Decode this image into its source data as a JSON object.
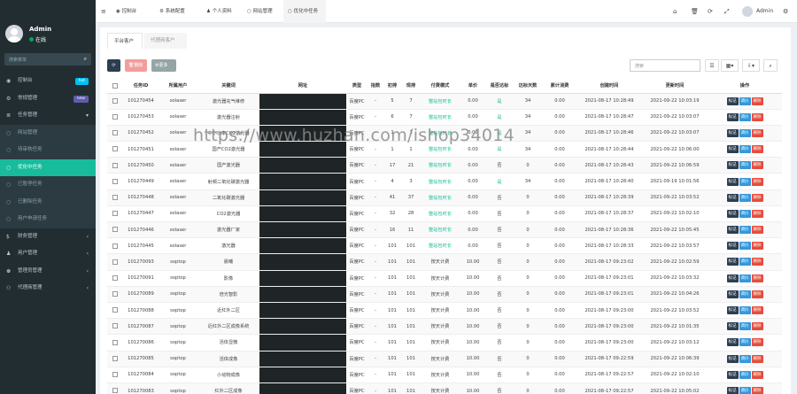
{
  "user": {
    "name": "Admin",
    "status": "在线"
  },
  "sidebar": {
    "search_placeholder": "搜索菜单",
    "items": [
      {
        "label": "控制台",
        "icon": "dashboard-icon",
        "badge": "hot",
        "badge_color": "#00c0ef",
        "kind": "top"
      },
      {
        "label": "常规管理",
        "icon": "gear-icon",
        "badge": "new",
        "badge_color": "#605ca8",
        "kind": "top"
      },
      {
        "label": "任务管理",
        "icon": "list-icon",
        "arrow": "▾",
        "kind": "top"
      },
      {
        "label": "网站管理",
        "icon": "circle-icon",
        "kind": "sub"
      },
      {
        "label": "待审核任务",
        "icon": "circle-icon",
        "kind": "sub"
      },
      {
        "label": "优化中任务",
        "icon": "circle-icon",
        "kind": "active"
      },
      {
        "label": "已暂停任务",
        "icon": "circle-icon",
        "kind": "sub"
      },
      {
        "label": "已删除任务",
        "icon": "circle-icon",
        "kind": "sub"
      },
      {
        "label": "用户申请任务",
        "icon": "circle-icon",
        "kind": "sub"
      },
      {
        "label": "财务管理",
        "icon": "money-icon",
        "arrow": "‹",
        "kind": "top"
      },
      {
        "label": "用户管理",
        "icon": "user-icon",
        "arrow": "‹",
        "kind": "top"
      },
      {
        "label": "管理员管理",
        "icon": "users-icon",
        "arrow": "‹",
        "kind": "top"
      },
      {
        "label": "代理商管理",
        "icon": "group-icon",
        "arrow": "‹",
        "kind": "top"
      }
    ]
  },
  "topnav": {
    "items": [
      "控制台",
      "系统配置",
      "个人资料",
      "网站管理",
      "优化中任务"
    ],
    "admin_name": "Admin"
  },
  "tabs": [
    "平台客户",
    "代理商客户"
  ],
  "toolbar": {
    "delete": "删除",
    "more": "更多",
    "search_placeholder": "搜索"
  },
  "table": {
    "headers": [
      "任务ID",
      "所属用户",
      "关键词",
      "网址",
      "类型",
      "指数",
      "初排",
      "现排",
      "付费模式",
      "单价",
      "是否达标",
      "达标天数",
      "累计消费",
      "创建时间",
      "更新时间",
      "操作"
    ],
    "actions": [
      "标记",
      "调价",
      "删除"
    ],
    "rows": [
      [
        "101270454",
        "xolaser",
        "激光器充气维修",
        "",
        "百度PC",
        "-",
        "5",
        "7",
        "整站包时长",
        "0.00",
        "是",
        "34",
        "0.00",
        "2021-08-17 10:28:49",
        "2021-09-22 10:03:19"
      ],
      [
        "101270453",
        "xolaser",
        "激光器注射",
        "",
        "百度PC",
        "-",
        "6",
        "7",
        "整站包时长",
        "0.00",
        "是",
        "34",
        "0.00",
        "2021-08-17 10:28:47",
        "2021-09-22 10:03:07"
      ],
      [
        "101270452",
        "xolaser",
        "中小功率CO2激光器",
        "",
        "百度PC",
        "-",
        "1",
        "1",
        "整站包时长",
        "0.00",
        "是",
        "34",
        "0.00",
        "2021-08-17 10:28:46",
        "2021-09-22 10:03:07"
      ],
      [
        "101270451",
        "xolaser",
        "国产CO2激光器",
        "",
        "百度PC",
        "-",
        "1",
        "1",
        "整站包时长",
        "0.00",
        "是",
        "34",
        "0.00",
        "2021-08-17 10:28:44",
        "2021-09-22 10:06:00"
      ],
      [
        "101270450",
        "xolaser",
        "国产激光器",
        "",
        "百度PC",
        "-",
        "17",
        "21",
        "整站包时长",
        "0.00",
        "否",
        "0",
        "0.00",
        "2021-08-17 10:28:43",
        "2021-09-22 10:06:59"
      ],
      [
        "101270449",
        "xolaser",
        "射频二氧化碳激光器",
        "",
        "百度PC",
        "-",
        "4",
        "3",
        "整站包时长",
        "0.00",
        "是",
        "34",
        "0.00",
        "2021-08-17 10:28:40",
        "2021-09-19 10:01:56"
      ],
      [
        "101270448",
        "xolaser",
        "二氧化碳激光器",
        "",
        "百度PC",
        "-",
        "41",
        "37",
        "整站包时长",
        "0.00",
        "否",
        "0",
        "0.00",
        "2021-08-17 10:28:39",
        "2021-09-22 10:03:52"
      ],
      [
        "101270447",
        "xolaser",
        "CO2激光器",
        "",
        "百度PC",
        "-",
        "32",
        "28",
        "整站包时长",
        "0.00",
        "否",
        "0",
        "0.00",
        "2021-08-17 10:28:37",
        "2021-09-22 10:02:10"
      ],
      [
        "101270446",
        "xolaser",
        "激光器厂家",
        "",
        "百度PC",
        "-",
        "16",
        "11",
        "整站包时长",
        "0.00",
        "否",
        "0",
        "0.00",
        "2021-08-17 10:28:36",
        "2021-09-22 10:05:45"
      ],
      [
        "101270445",
        "xolaser",
        "激光器",
        "",
        "百度PC",
        "-",
        "101",
        "101",
        "整站包时长",
        "0.00",
        "否",
        "0",
        "0.00",
        "2021-08-17 10:28:33",
        "2021-09-22 10:03:57"
      ],
      [
        "101270093",
        "soptop",
        "晨曦",
        "",
        "百度PC",
        "-",
        "101",
        "101",
        "按天计费",
        "10.00",
        "否",
        "0",
        "0.00",
        "2021-08-17 09:23:02",
        "2021-09-22 10:02:59"
      ],
      [
        "101270091",
        "soptop",
        "影像",
        "",
        "百度PC",
        "-",
        "101",
        "101",
        "按天计费",
        "10.00",
        "否",
        "0",
        "0.00",
        "2021-08-17 09:23:01",
        "2021-09-22 10:03:32"
      ],
      [
        "101270089",
        "soptop",
        "倍光智影",
        "",
        "百度PC",
        "-",
        "101",
        "101",
        "按天计费",
        "10.00",
        "否",
        "0",
        "0.00",
        "2021-08-17 09:23:01",
        "2021-09-22 10:04:26"
      ],
      [
        "101270088",
        "soptop",
        "近红外二区",
        "",
        "百度PC",
        "-",
        "101",
        "101",
        "按天计费",
        "10.00",
        "否",
        "0",
        "0.00",
        "2021-08-17 09:23:00",
        "2021-09-22 10:03:52"
      ],
      [
        "101270087",
        "soptop",
        "近红外二区成像系统",
        "",
        "百度PC",
        "-",
        "101",
        "101",
        "按天计费",
        "10.00",
        "否",
        "0",
        "0.00",
        "2021-08-17 09:23:00",
        "2021-09-22 10:01:35"
      ],
      [
        "101270086",
        "soptop",
        "活体显微",
        "",
        "百度PC",
        "-",
        "101",
        "101",
        "按天计费",
        "10.00",
        "否",
        "0",
        "0.00",
        "2021-08-17 09:23:00",
        "2021-09-22 10:03:12"
      ],
      [
        "101270085",
        "soptop",
        "活体成像",
        "",
        "百度PC",
        "-",
        "101",
        "101",
        "按天计费",
        "10.00",
        "否",
        "0",
        "0.00",
        "2021-08-17 09:22:59",
        "2021-09-22 10:06:39"
      ],
      [
        "101270084",
        "soptop",
        "小动物成像",
        "",
        "百度PC",
        "-",
        "101",
        "101",
        "按天计费",
        "10.00",
        "否",
        "0",
        "0.00",
        "2021-08-17 09:22:57",
        "2021-09-22 10:02:10"
      ],
      [
        "101270083",
        "soptop",
        "红外二区成像",
        "",
        "百度PC",
        "-",
        "101",
        "101",
        "按天计费",
        "10.00",
        "否",
        "0",
        "0.00",
        "2021-08-17 09:22:57",
        "2021-09-22 10:05:02"
      ]
    ]
  },
  "watermark": "https://www.huzhan.com/ishop34014",
  "colors": {
    "sidebar": "#222d32",
    "accent": "#18bc9c",
    "action_mark": "#2c3e50",
    "action_price": "#3498db",
    "action_delete": "#e74c3c"
  }
}
